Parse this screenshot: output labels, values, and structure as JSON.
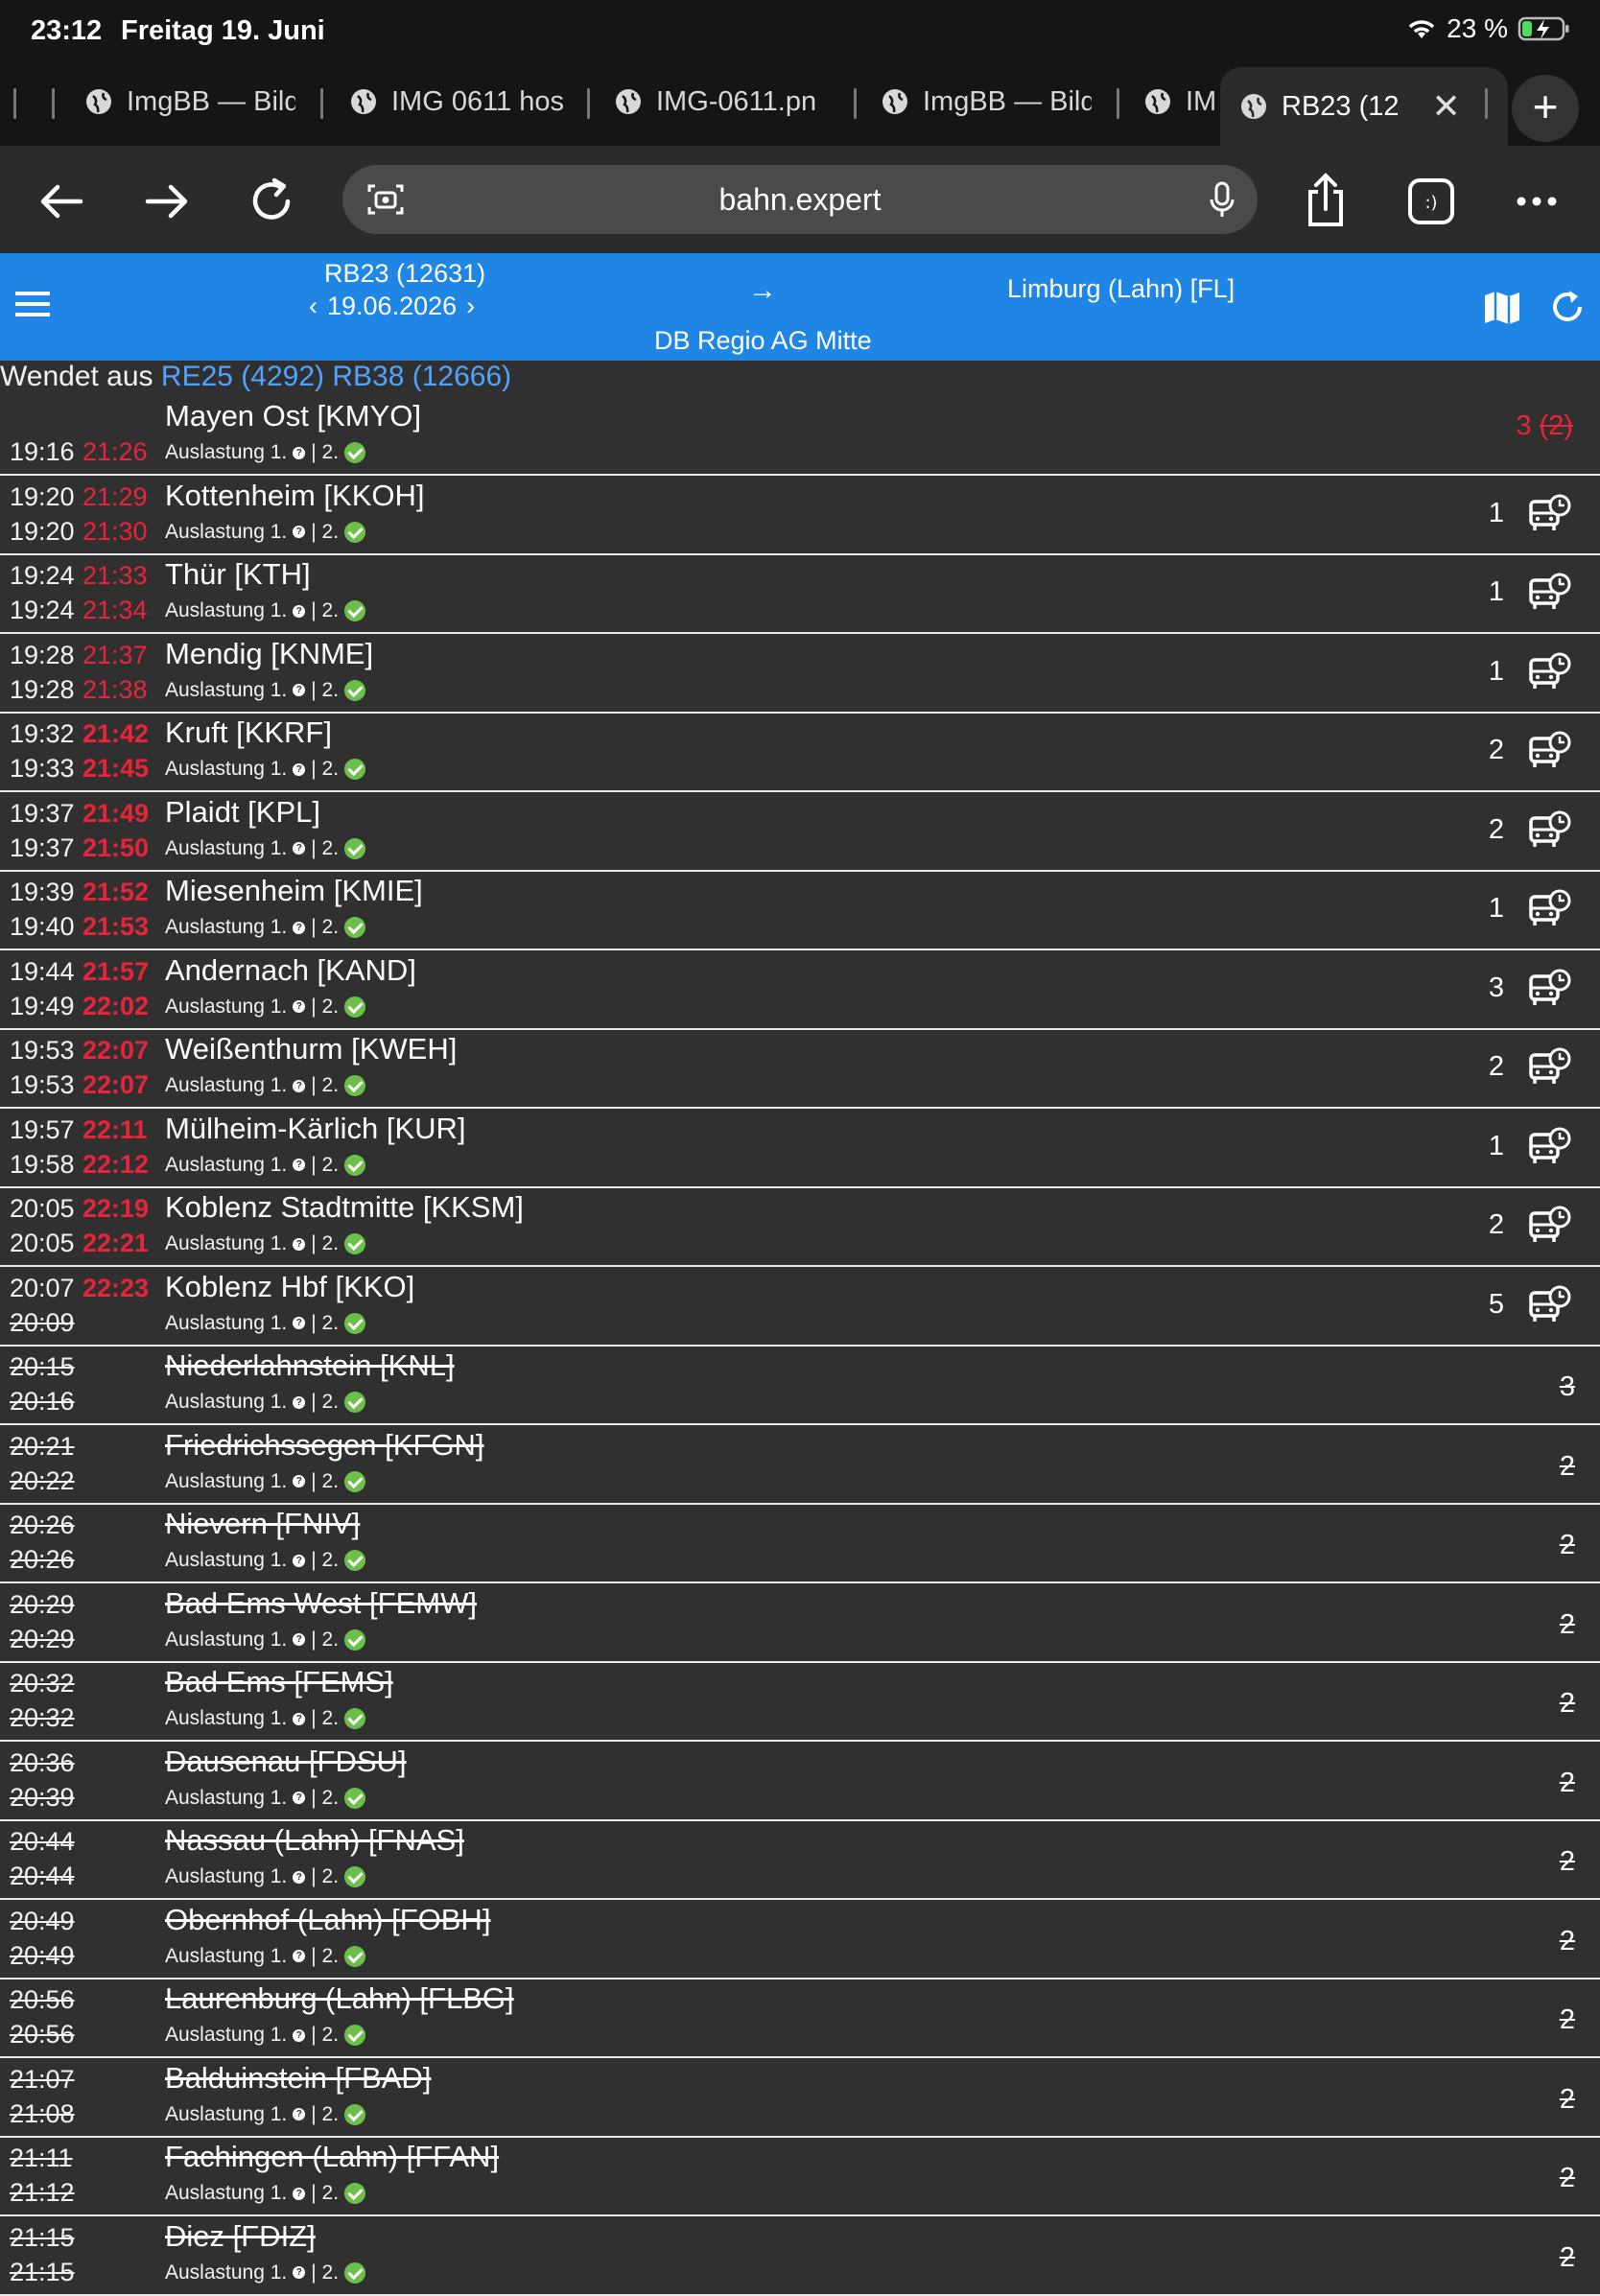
{
  "status": {
    "time": "23:12",
    "date": "Freitag 19. Juni",
    "battery": "23 %"
  },
  "tabs": [
    {
      "label": "ImgBB — Bild"
    },
    {
      "label": "IMG 0611 hos"
    },
    {
      "label": "IMG-0611.pn"
    },
    {
      "label": "ImgBB — Bild"
    },
    {
      "label": "IM"
    },
    {
      "label": "RB23 (12"
    }
  ],
  "toolbar": {
    "url": "bahn.expert"
  },
  "header": {
    "train": "RB23 (12631)",
    "date": "19.06.2026",
    "arrow": "→",
    "destination": "Limburg (Lahn) [FL]",
    "operator": "DB Regio AG Mitte"
  },
  "wendet": {
    "prefix": "Wendet aus",
    "link1": "RE25 (4292)",
    "link2": "RB38 (12666)"
  },
  "load_text": {
    "first": "Auslastung 1.",
    "sep": "| 2."
  },
  "stops": [
    {
      "arr": "",
      "dep": "19:16",
      "arr_delay": "",
      "dep_delay": "21:26",
      "name": "Mayen Ost [KMYO]",
      "platform": "3",
      "platform_old": "(2)",
      "cancelled": false,
      "bus": false,
      "bold": false
    },
    {
      "arr": "19:20",
      "dep": "19:20",
      "arr_delay": "21:29",
      "dep_delay": "21:30",
      "name": "Kottenheim [KKOH]",
      "platform": "1",
      "cancelled": false,
      "bus": true,
      "bold": false
    },
    {
      "arr": "19:24",
      "dep": "19:24",
      "arr_delay": "21:33",
      "dep_delay": "21:34",
      "name": "Thür [KTH]",
      "platform": "1",
      "cancelled": false,
      "bus": true,
      "bold": false
    },
    {
      "arr": "19:28",
      "dep": "19:28",
      "arr_delay": "21:37",
      "dep_delay": "21:38",
      "name": "Mendig [KNME]",
      "platform": "1",
      "cancelled": false,
      "bus": true,
      "bold": false
    },
    {
      "arr": "19:32",
      "dep": "19:33",
      "arr_delay": "21:42",
      "dep_delay": "21:45",
      "name": "Kruft [KKRF]",
      "platform": "2",
      "cancelled": false,
      "bus": true,
      "bold": true
    },
    {
      "arr": "19:37",
      "dep": "19:37",
      "arr_delay": "21:49",
      "dep_delay": "21:50",
      "name": "Plaidt [KPL]",
      "platform": "2",
      "cancelled": false,
      "bus": true,
      "bold": true
    },
    {
      "arr": "19:39",
      "dep": "19:40",
      "arr_delay": "21:52",
      "dep_delay": "21:53",
      "name": "Miesenheim [KMIE]",
      "platform": "1",
      "cancelled": false,
      "bus": true,
      "bold": true
    },
    {
      "arr": "19:44",
      "dep": "19:49",
      "arr_delay": "21:57",
      "dep_delay": "22:02",
      "name": "Andernach [KAND]",
      "platform": "3",
      "cancelled": false,
      "bus": true,
      "bold": true
    },
    {
      "arr": "19:53",
      "dep": "19:53",
      "arr_delay": "22:07",
      "dep_delay": "22:07",
      "name": "Weißenthurm [KWEH]",
      "platform": "2",
      "cancelled": false,
      "bus": true,
      "bold": true
    },
    {
      "arr": "19:57",
      "dep": "19:58",
      "arr_delay": "22:11",
      "dep_delay": "22:12",
      "name": "Mülheim-Kärlich [KUR]",
      "platform": "1",
      "cancelled": false,
      "bus": true,
      "bold": true
    },
    {
      "arr": "20:05",
      "dep": "20:05",
      "arr_delay": "22:19",
      "dep_delay": "22:21",
      "name": "Koblenz Stadtmitte [KKSM]",
      "platform": "2",
      "cancelled": false,
      "bus": true,
      "bold": true
    },
    {
      "arr": "20:07",
      "dep": "20:09",
      "arr_delay": "22:23",
      "dep_delay": "",
      "name": "Koblenz Hbf [KKO]",
      "platform": "5",
      "cancelled": false,
      "bus": true,
      "bold": true,
      "dep_struck": true
    },
    {
      "arr": "20:15",
      "dep": "20:16",
      "name": "Niederlahnstein [KNL]",
      "platform": "3",
      "cancelled": true
    },
    {
      "arr": "20:21",
      "dep": "20:22",
      "name": "Friedrichssegen [KFGN]",
      "platform": "2",
      "cancelled": true
    },
    {
      "arr": "20:26",
      "dep": "20:26",
      "name": "Nievern [FNIV]",
      "platform": "2",
      "cancelled": true
    },
    {
      "arr": "20:29",
      "dep": "20:29",
      "name": "Bad Ems West [FEMW]",
      "platform": "2",
      "cancelled": true
    },
    {
      "arr": "20:32",
      "dep": "20:32",
      "name": "Bad Ems [FEMS]",
      "platform": "2",
      "cancelled": true
    },
    {
      "arr": "20:36",
      "dep": "20:39",
      "name": "Dausenau [FDSU]",
      "platform": "2",
      "cancelled": true
    },
    {
      "arr": "20:44",
      "dep": "20:44",
      "name": "Nassau (Lahn) [FNAS]",
      "platform": "2",
      "cancelled": true
    },
    {
      "arr": "20:49",
      "dep": "20:49",
      "name": "Obernhof (Lahn) [FOBH]",
      "platform": "2",
      "cancelled": true
    },
    {
      "arr": "20:56",
      "dep": "20:56",
      "name": "Laurenburg (Lahn) [FLBG]",
      "platform": "2",
      "cancelled": true
    },
    {
      "arr": "21:07",
      "dep": "21:08",
      "name": "Balduinstein [FBAD]",
      "platform": "2",
      "cancelled": true
    },
    {
      "arr": "21:11",
      "dep": "21:12",
      "name": "Fachingen (Lahn) [FFAN]",
      "platform": "2",
      "cancelled": true
    },
    {
      "arr": "21:15",
      "dep": "21:15",
      "name": "Diez [FDIZ]",
      "platform": "2",
      "cancelled": true
    }
  ]
}
